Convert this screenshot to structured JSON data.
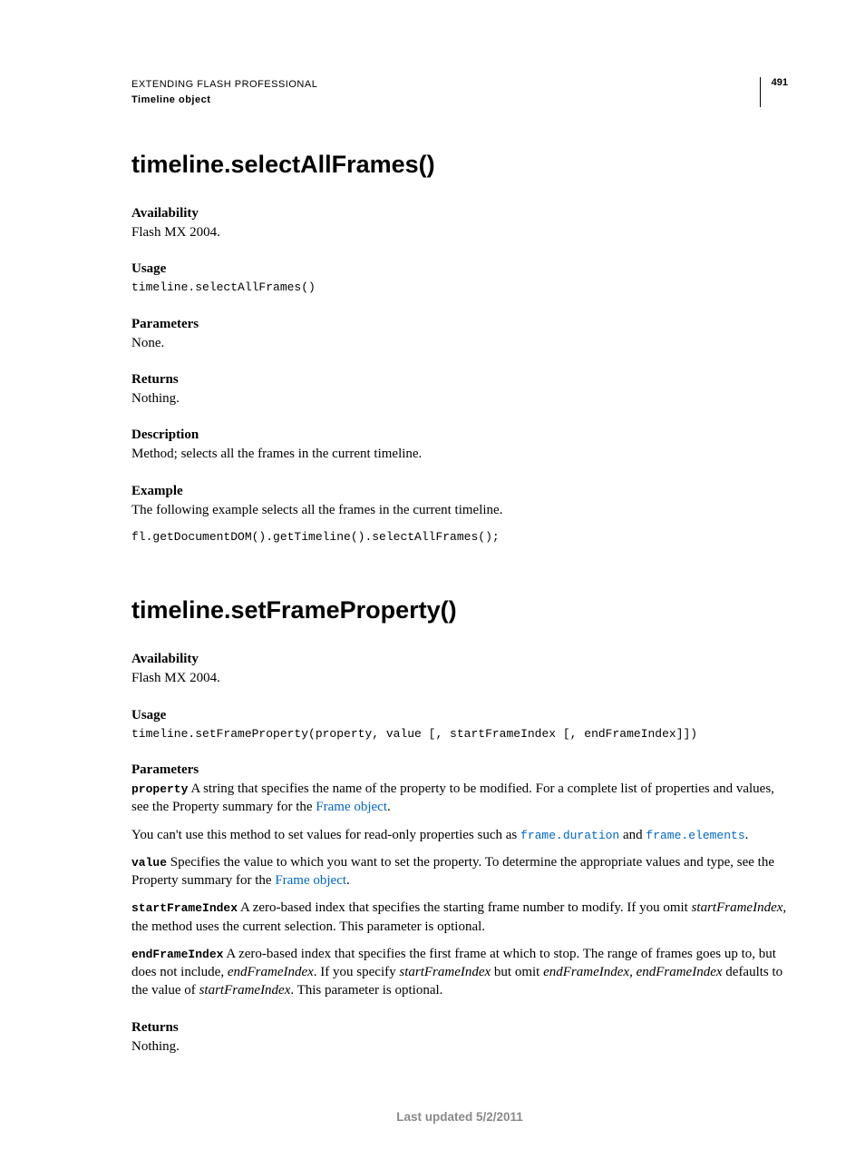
{
  "header": {
    "doc_title": "EXTENDING FLASH PROFESSIONAL",
    "section": "Timeline object",
    "page_number": "491"
  },
  "method1": {
    "title": "timeline.selectAllFrames()",
    "availability_label": "Availability",
    "availability_text": "Flash MX 2004.",
    "usage_label": "Usage",
    "usage_code": "timeline.selectAllFrames()",
    "parameters_label": "Parameters",
    "parameters_text": "None.",
    "returns_label": "Returns",
    "returns_text": "Nothing.",
    "description_label": "Description",
    "description_text": "Method; selects all the frames in the current timeline.",
    "example_label": "Example",
    "example_intro": "The following example selects all the frames in the current timeline.",
    "example_code": "fl.getDocumentDOM().getTimeline().selectAllFrames();"
  },
  "method2": {
    "title": "timeline.setFrameProperty()",
    "availability_label": "Availability",
    "availability_text": "Flash MX 2004.",
    "usage_label": "Usage",
    "usage_code": "timeline.setFrameProperty(property, value [, startFrameIndex [, endFrameIndex]])",
    "parameters_label": "Parameters",
    "param_property_name": "property",
    "param_property_text_a": "  A string that specifies the name of the property to be modified. For a complete list of properties and values, see the Property summary for the ",
    "param_property_link": "Frame object",
    "param_property_text_b": ".",
    "param_readonly_a": "You can't use this method to set values for read-only properties such as ",
    "param_readonly_code1": "frame.duration",
    "param_readonly_mid": " and ",
    "param_readonly_code2": "frame.elements",
    "param_readonly_b": ".",
    "param_value_name": "value",
    "param_value_text_a": "  Specifies the value to which you want to set the property. To determine the appropriate values and type, see the Property summary for the ",
    "param_value_link": "Frame object",
    "param_value_text_b": ".",
    "param_start_name": "startFrameIndex",
    "param_start_text_a": "  A zero-based index that specifies the starting frame number to modify. If you omit ",
    "param_start_italic": "startFrameIndex",
    "param_start_text_b": ", the method uses the current selection. This parameter is optional.",
    "param_end_name": "endFrameIndex",
    "param_end_text_a": "  A zero-based index that specifies the first frame at which to stop. The range of frames goes up to, but does not include, ",
    "param_end_italic1": "endFrameIndex",
    "param_end_text_b": ". If you specify ",
    "param_end_italic2": "startFrameIndex",
    "param_end_text_c": " but omit ",
    "param_end_italic3": "endFrameIndex",
    "param_end_text_d": ", ",
    "param_end_italic4": "endFrameIndex",
    "param_end_text_e": " defaults to the value of ",
    "param_end_italic5": "startFrameIndex",
    "param_end_text_f": ". This parameter is optional.",
    "returns_label": "Returns",
    "returns_text": "Nothing."
  },
  "footer": {
    "updated": "Last updated 5/2/2011"
  }
}
